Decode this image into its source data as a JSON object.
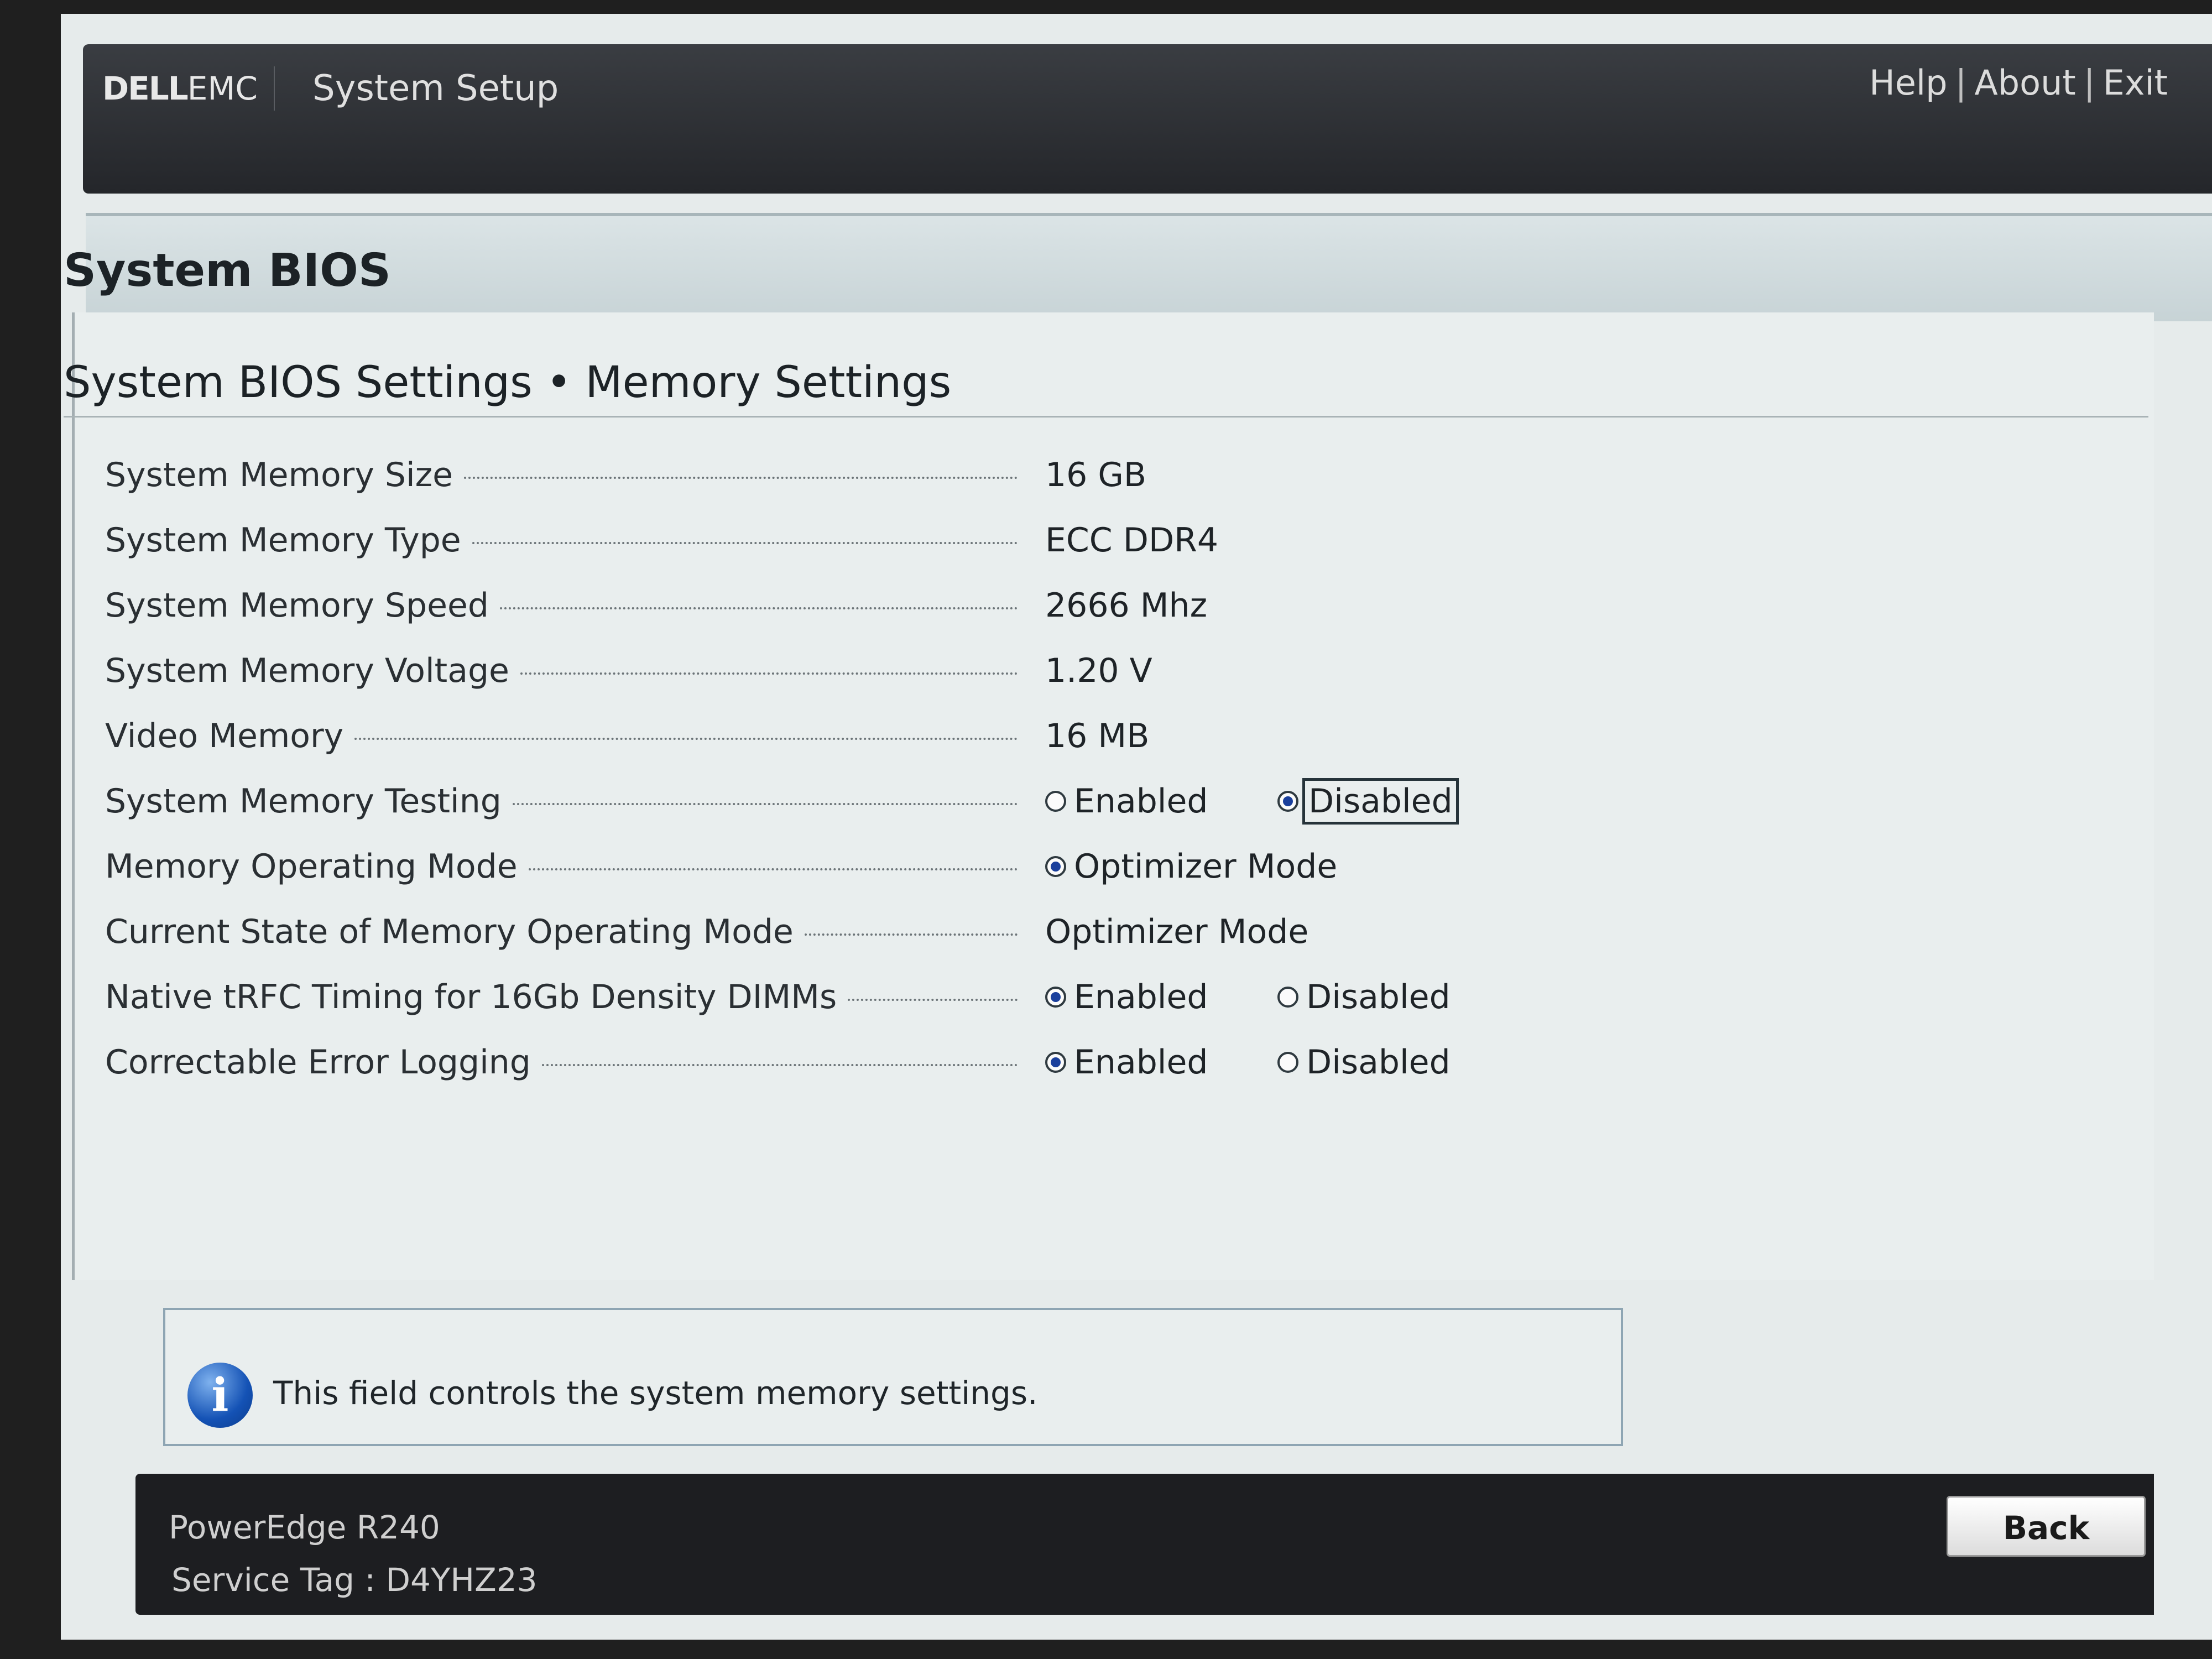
{
  "header": {
    "logo_dell": "DELL",
    "logo_emc": "EMC",
    "app_title": "System Setup",
    "links": [
      "Help",
      "About",
      "Exit"
    ],
    "separator": "|"
  },
  "page": {
    "title": "System BIOS",
    "section_title": "System BIOS Settings • Memory Settings"
  },
  "settings": [
    {
      "label": "System Memory Size",
      "value": "16 GB"
    },
    {
      "label": "System Memory Type",
      "value": "ECC DDR4"
    },
    {
      "label": "System Memory Speed",
      "value": "2666 Mhz"
    },
    {
      "label": "System Memory Voltage",
      "value": "1.20 V"
    },
    {
      "label": "Video Memory",
      "value": "16 MB"
    },
    {
      "label": "System Memory Testing",
      "options": [
        "Enabled",
        "Disabled"
      ],
      "selected": "Disabled"
    },
    {
      "label": "Memory Operating Mode",
      "options": [
        "Optimizer Mode"
      ],
      "selected": "Optimizer Mode"
    },
    {
      "label": "Current State of Memory Operating Mode",
      "value": "Optimizer Mode"
    },
    {
      "label": "Native tRFC Timing for 16Gb Density DIMMs",
      "options": [
        "Enabled",
        "Disabled"
      ],
      "selected": "Enabled"
    },
    {
      "label": "Correctable Error Logging",
      "options": [
        "Enabled",
        "Disabled"
      ],
      "selected": "Enabled"
    }
  ],
  "help": {
    "icon": "info-icon",
    "icon_glyph": "i",
    "text": "This field controls the system memory settings."
  },
  "footer": {
    "model": "PowerEdge R240",
    "service_tag": "Service Tag : D4YHZ23",
    "back_label": "Back"
  },
  "colors": {
    "radio_selected": "#1a3f9c",
    "header_bg": "#2c2e32",
    "panel_bg": "#e9eeee"
  }
}
